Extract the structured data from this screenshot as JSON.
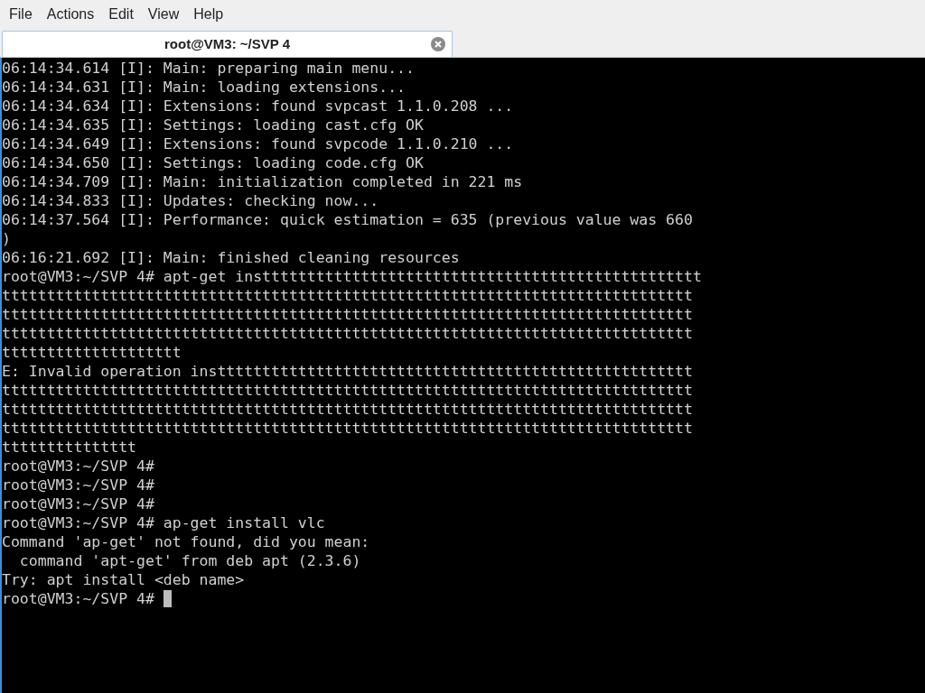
{
  "menu": [
    "File",
    "Actions",
    "Edit",
    "View",
    "Help"
  ],
  "tabs": [
    {
      "title": "root@VM3: ~/SVP 4",
      "selected": true
    }
  ],
  "terminal": {
    "lines": [
      "06:14:34.614 [I]: Main: preparing main menu...",
      "06:14:34.631 [I]: Main: loading extensions...",
      "06:14:34.634 [I]: Extensions: found svpcast 1.1.0.208 ...",
      "06:14:34.635 [I]: Settings: loading cast.cfg OK",
      "06:14:34.649 [I]: Extensions: found svpcode 1.1.0.210 ...",
      "06:14:34.650 [I]: Settings: loading code.cfg OK",
      "06:14:34.709 [I]: Main: initialization completed in 221 ms",
      "06:14:34.833 [I]: Updates: checking now...",
      "06:14:37.564 [I]: Performance: quick estimation = 635 (previous value was 660",
      ")",
      "06:16:21.692 [I]: Main: finished cleaning resources",
      "root@VM3:~/SVP 4# apt-get insttttttttttttttttttttttttttttttttttttttttttttttttt",
      "ttttttttttttttttttttttttttttttttttttttttttttttttttttttttttttttttttttttttttttt",
      "ttttttttttttttttttttttttttttttttttttttttttttttttttttttttttttttttttttttttttttt",
      "ttttttttttttttttttttttttttttttttttttttttttttttttttttttttttttttttttttttttttttt",
      "tttttttttttttttttttt",
      "E: Invalid operation insttttttttttttttttttttttttttttttttttttttttttttttttttttt",
      "ttttttttttttttttttttttttttttttttttttttttttttttttttttttttttttttttttttttttttttt",
      "ttttttttttttttttttttttttttttttttttttttttttttttttttttttttttttttttttttttttttttt",
      "ttttttttttttttttttttttttttttttttttttttttttttttttttttttttttttttttttttttttttttt",
      "ttttttttttttttt",
      "root@VM3:~/SVP 4#",
      "root@VM3:~/SVP 4#",
      "root@VM3:~/SVP 4#",
      "root@VM3:~/SVP 4# ap-get install vlc",
      "Command 'ap-get' not found, did you mean:",
      "  command 'apt-get' from deb apt (2.3.6)",
      "Try: apt install <deb name>"
    ],
    "prompt": "root@VM3:~/SVP 4#"
  }
}
